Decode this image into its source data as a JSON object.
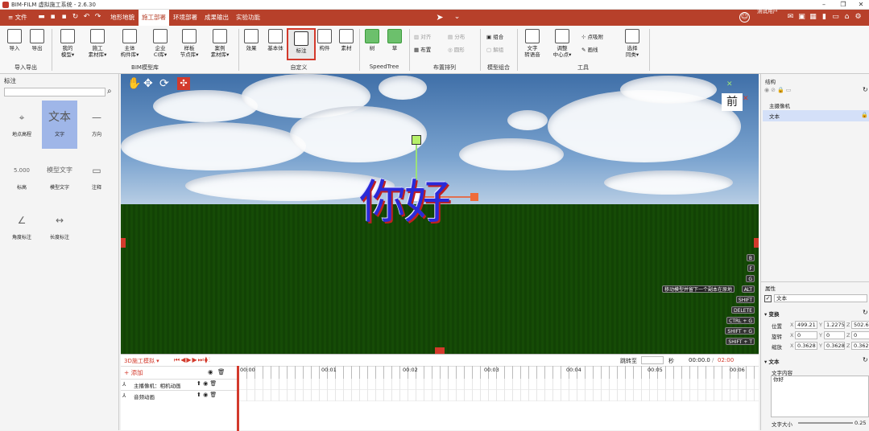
{
  "app": {
    "title": "BIM-FILM 虚拟施工系统 - 2.6.30"
  },
  "menu": {
    "items": [
      "文件",
      "地形地貌",
      "施工部署",
      "环境部署",
      "成果输出",
      "实验功能"
    ],
    "active": "施工部署",
    "user": "测试用户"
  },
  "ribbon": {
    "buttons": [
      {
        "label": "导入",
        "icon": "import-icon"
      },
      {
        "label": "导出",
        "icon": "export-icon"
      },
      {
        "label": "我的\n模型▾",
        "icon": "my-model-icon"
      },
      {
        "label": "施工\n素材库▾",
        "icon": "material-lib-icon"
      },
      {
        "label": "主体\n构件库▾",
        "icon": "component-lib-icon"
      },
      {
        "label": "企业\nCI库▾",
        "icon": "ci-lib-icon"
      },
      {
        "label": "样板\n节点库▾",
        "icon": "node-lib-icon"
      },
      {
        "label": "案例\n素材库▾",
        "icon": "case-lib-icon"
      },
      {
        "label": "效果",
        "icon": "effect-icon"
      },
      {
        "label": "基本体",
        "icon": "primitive-icon"
      },
      {
        "label": "标注",
        "icon": "annotation-icon"
      },
      {
        "label": "构件",
        "icon": "component-icon"
      },
      {
        "label": "素材",
        "icon": "asset-icon"
      },
      {
        "label": "树",
        "icon": "tree-icon"
      },
      {
        "label": "草",
        "icon": "grass-icon"
      },
      {
        "label": "文字\n转语音",
        "icon": "text-to-speech-icon"
      },
      {
        "label": "调整\n中心点▾",
        "icon": "center-point-icon"
      },
      {
        "label": "选择\n同类▾",
        "icon": "select-similar-icon"
      }
    ],
    "small": {
      "align": "对齐",
      "distribute": "分布",
      "layout": "布置",
      "circle": "圆形",
      "group": "组合",
      "ungroup": "解组",
      "snap": "点吸附",
      "draw_line": "画线"
    },
    "groups": {
      "import_export": "导入导出",
      "bim_lib": "BIM模型库",
      "custom": "自定义",
      "speedtree": "SpeedTree",
      "arrange": "布置排列",
      "model_group": "模型组合",
      "tools": "工具"
    }
  },
  "left_panel": {
    "title": "标注",
    "search_placeholder": "",
    "tools": [
      {
        "label": "地点高程",
        "glyph": "⌖"
      },
      {
        "label": "文字",
        "glyph": "文本"
      },
      {
        "label": "方向",
        "glyph": "—"
      },
      {
        "label": "标高",
        "glyph": "5.000"
      },
      {
        "label": "模型文字",
        "glyph": "模型文字"
      },
      {
        "label": "注释",
        "glyph": "▭"
      },
      {
        "label": "角度标注",
        "glyph": "∠"
      },
      {
        "label": "长度标注",
        "glyph": "↔"
      }
    ]
  },
  "viewport": {
    "text3d": "你好",
    "view_label": "前",
    "hint": "移动模型并留下一个副本在原地",
    "shortcuts": [
      "B",
      "F",
      "G",
      "ALT",
      "SHIFT",
      "DELETE",
      "CTRL + G",
      "SHIFT + G",
      "SHIFT + T"
    ]
  },
  "timeline": {
    "mode": "3D施工模拟 ▾",
    "add_label": "+ 添加",
    "jump_label": "跳转至",
    "seconds": "秒",
    "current": "00:00.0",
    "total": "02:00",
    "ticks": [
      "00:00",
      "00:01",
      "00:02",
      "00:03",
      "00:04",
      "00:05",
      "00:06"
    ],
    "tracks": [
      "主播像机：相机动画",
      "音频动画"
    ]
  },
  "right_panel": {
    "structure_title": "结构",
    "tree": [
      "主摄像机",
      "文本"
    ],
    "props_title": "属性",
    "obj_name": "文本",
    "transform_title": "变换",
    "position": {
      "label": "位置",
      "x": "499.21",
      "y": "1.2275",
      "z": "502.63"
    },
    "rotation": {
      "label": "旋转",
      "x": "0",
      "y": "0",
      "z": "0"
    },
    "scale": {
      "label": "缩放",
      "x": "0.3628",
      "y": "0.3628",
      "z": "0.3628"
    },
    "text_section": "文本",
    "text_content_label": "文字内容",
    "text_content": "你好",
    "font_size_label": "文字大小",
    "font_size_value": "0.25"
  },
  "colors": {
    "brand": "#b7402a",
    "highlight": "#d33a2c",
    "selected": "#9fb6e8"
  }
}
